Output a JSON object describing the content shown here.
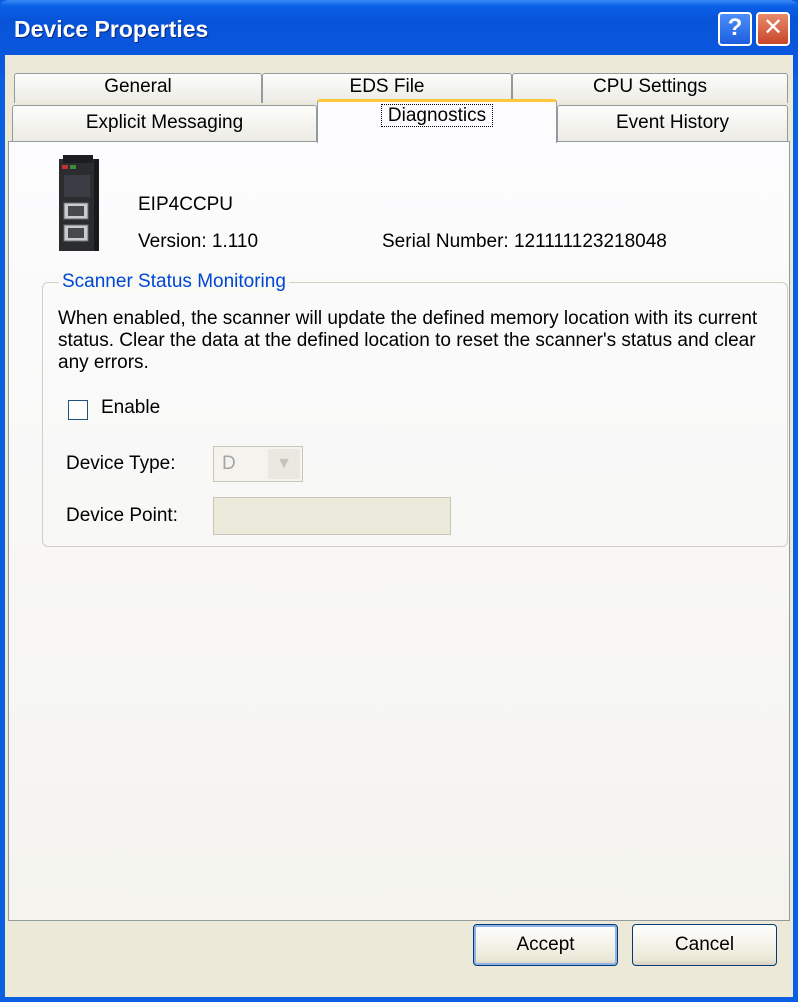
{
  "window": {
    "title": "Device Properties",
    "help_glyph": "?",
    "close_glyph": "✕"
  },
  "tabs": {
    "row1": [
      "General",
      "EDS File",
      "CPU Settings"
    ],
    "row2": [
      "Explicit Messaging",
      "Diagnostics",
      "Event History"
    ],
    "active": "Diagnostics"
  },
  "device": {
    "name": "EIP4CCPU",
    "version": "Version: 1.110",
    "serial": "Serial Number: 121111123218048",
    "icon": "device-module-icon"
  },
  "scanner": {
    "group_title": "Scanner Status Monitoring",
    "description": "When enabled, the scanner will update the defined memory location with its current status. Clear the data at the defined location to reset the scanner's status and clear any errors.",
    "enable_label": "Enable",
    "enable_checked": false,
    "device_type_label": "Device Type:",
    "device_type_value": "D",
    "device_point_label": "Device Point:",
    "device_point_value": ""
  },
  "buttons": {
    "accept": "Accept",
    "cancel": "Cancel"
  },
  "colors": {
    "titlebar": "#0854d8",
    "group_title": "#0046d5",
    "active_tab_accent": "#ffc83c",
    "dialog_bg": "#ece9d8"
  }
}
